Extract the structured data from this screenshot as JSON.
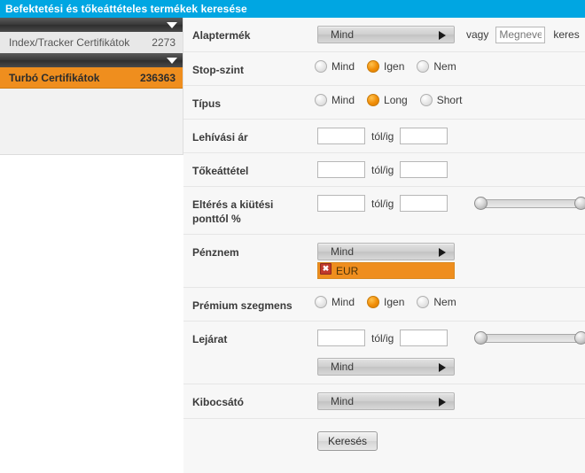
{
  "window": {
    "title": "Befektetési és tőkeáttételes termékek keresése"
  },
  "sidebar": {
    "groups": [
      {
        "label": "Index/Tracker Certifikátok",
        "count": "2273",
        "selected": false
      },
      {
        "label": "Turbó Certifikátok",
        "count": "236363",
        "selected": true
      }
    ]
  },
  "form": {
    "rows": {
      "alaptermek": {
        "label": "Alaptermék",
        "select_value": "Mind",
        "or_text": "vagy",
        "name_placeholder": "Megnevezés",
        "search_text": "keres"
      },
      "stop_szint": {
        "label": "Stop-szint",
        "options": [
          "Mind",
          "Igen",
          "Nem"
        ],
        "selected": "Igen"
      },
      "tipus": {
        "label": "Típus",
        "options": [
          "Mind",
          "Long",
          "Short"
        ],
        "selected": "Long"
      },
      "lehivasi_ar": {
        "label": "Lehívási ár",
        "from": "",
        "to": "",
        "between": "tól/ig"
      },
      "tokeattetel": {
        "label": "Tőkeáttétel",
        "from": "",
        "to": "",
        "between": "tól/ig"
      },
      "elteres": {
        "label": "Eltérés a kiütési ponttól %",
        "from": "",
        "to": "",
        "between": "tól/ig"
      },
      "penznem": {
        "label": "Pénznem",
        "select_value": "Mind",
        "tokens": [
          "EUR"
        ],
        "remove_glyph": "✖"
      },
      "premium": {
        "label": "Prémium szegmens",
        "options": [
          "Mind",
          "Igen",
          "Nem"
        ],
        "selected": "Igen"
      },
      "lejarat": {
        "label": "Lejárat",
        "from": "",
        "to": "",
        "between": "tól/ig",
        "select_value": "Mind"
      },
      "kibocsato": {
        "label": "Kibocsátó",
        "select_value": "Mind"
      }
    },
    "submit_label": "Keresés"
  },
  "colors": {
    "titlebar": "#00a6e2",
    "accent_orange": "#ef8e1e",
    "radio_on": "#f08d07",
    "remove_red": "#c0392b"
  }
}
